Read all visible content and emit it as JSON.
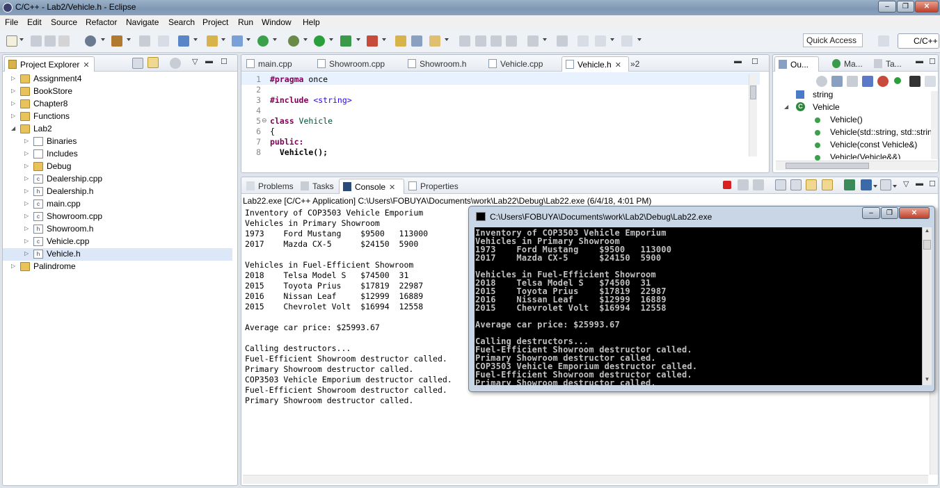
{
  "window": {
    "title": "C/C++ - Lab2/Vehicle.h - Eclipse"
  },
  "menu": [
    "File",
    "Edit",
    "Source",
    "Refactor",
    "Navigate",
    "Search",
    "Project",
    "Run",
    "Window",
    "Help"
  ],
  "toolbar": {
    "quick_access": "Quick Access",
    "perspective": "C/C++"
  },
  "project_explorer": {
    "title": "Project Explorer",
    "items": [
      {
        "label": "Assignment4",
        "icon": "project-icon"
      },
      {
        "label": "BookStore",
        "icon": "project-icon"
      },
      {
        "label": "Chapter8",
        "icon": "project-icon"
      },
      {
        "label": "Functions",
        "icon": "project-icon"
      },
      {
        "label": "Lab2",
        "icon": "project-icon"
      },
      {
        "label": "Binaries",
        "icon": "binaries-icon"
      },
      {
        "label": "Includes",
        "icon": "includes-icon"
      },
      {
        "label": "Debug",
        "icon": "folder-icon"
      },
      {
        "label": "Dealership.cpp",
        "icon": "cpp-file-icon"
      },
      {
        "label": "Dealership.h",
        "icon": "header-file-icon"
      },
      {
        "label": "main.cpp",
        "icon": "cpp-file-icon"
      },
      {
        "label": "Showroom.cpp",
        "icon": "cpp-file-icon"
      },
      {
        "label": "Showroom.h",
        "icon": "header-file-icon"
      },
      {
        "label": "Vehicle.cpp",
        "icon": "cpp-file-icon"
      },
      {
        "label": "Vehicle.h",
        "icon": "header-file-icon"
      },
      {
        "label": "Palindrome",
        "icon": "project-icon"
      }
    ]
  },
  "editor": {
    "tabs": [
      "main.cpp",
      "Showroom.cpp",
      "Showroom.h",
      "Vehicle.cpp",
      "Vehicle.h"
    ],
    "overflow": "»2",
    "lines": [
      "1",
      "2",
      "3",
      "4",
      "5",
      "6",
      "7",
      "8"
    ],
    "code": {
      "l1_kw": "#pragma",
      "l1_rest": " once",
      "l3_kw": "#include",
      "l3_str": " <string>",
      "l5_kw": "class",
      "l5_ty": " Vehicle",
      "l6": "{",
      "l7_kw": "public:",
      "l8": "  Vehicle();"
    }
  },
  "outline": {
    "tabs": [
      "Ou...",
      "Ma...",
      "Ta..."
    ],
    "items": [
      "string",
      "Vehicle",
      "Vehicle()",
      "Vehicle(std::string, std::string",
      "Vehicle(const Vehicle&)",
      "Vehicle(Vehicle&&)"
    ]
  },
  "bottom": {
    "tabs": [
      "Problems",
      "Tasks",
      "Console",
      "Properties"
    ],
    "console_header": "Lab22.exe [C/C++ Application] C:\\Users\\FOBUYA\\Documents\\work\\Lab22\\Debug\\Lab22.exe (6/4/18, 4:01 PM)",
    "output": [
      "Inventory of COP3503 Vehicle Emporium",
      "Vehicles in Primary Showroom",
      "1973    Ford Mustang    $9500   113000",
      "2017    Mazda CX-5      $24150  5900",
      "",
      "Vehicles in Fuel-Efficient Showroom",
      "2018    Telsa Model S   $74500  31",
      "2015    Toyota Prius    $17819  22987",
      "2016    Nissan Leaf     $12999  16889",
      "2015    Chevrolet Volt  $16994  12558",
      "",
      "Average car price: $25993.67",
      "",
      "Calling destructors...",
      "Fuel-Efficient Showroom destructor called.",
      "Primary Showroom destructor called.",
      "COP3503 Vehicle Emporium destructor called.",
      "Fuel-Efficient Showroom destructor called.",
      "Primary Showroom destructor called."
    ]
  },
  "cmd_window": {
    "title": "C:\\Users\\FOBUYA\\Documents\\work\\Lab2\\Debug\\Lab22.exe",
    "lines": [
      "Inventory of COP3503 Vehicle Emporium",
      "Vehicles in Primary Showroom",
      "1973    Ford Mustang    $9500   113000",
      "2017    Mazda CX-5      $24150  5900",
      "",
      "Vehicles in Fuel-Efficient Showroom",
      "2018    Telsa Model S   $74500  31",
      "2015    Toyota Prius    $17819  22987",
      "2016    Nissan Leaf     $12999  16889",
      "2015    Chevrolet Volt  $16994  12558",
      "",
      "Average car price: $25993.67",
      "",
      "Calling destructors...",
      "Fuel-Efficient Showroom destructor called.",
      "Primary Showroom destructor called.",
      "COP3503 Vehicle Emporium destructor called.",
      "Fuel-Efficient Showroom destructor called.",
      "Primary Showroom destructor called."
    ]
  },
  "colors": {
    "keyword": "#7f0055",
    "string": "#2a00ff",
    "type": "#005032",
    "terminal_bg": "#000000",
    "terminal_fg": "#c0c0c0"
  }
}
